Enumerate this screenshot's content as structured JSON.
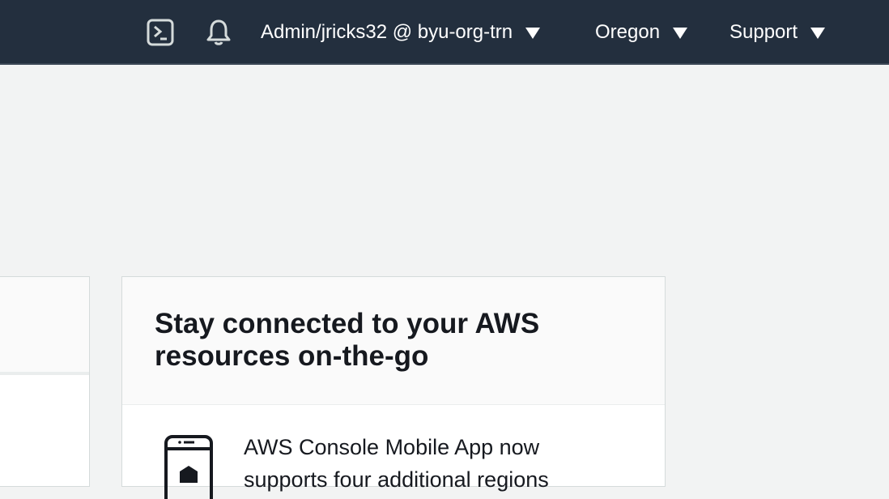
{
  "topbar": {
    "cloudshell_icon": "terminal-prompt-icon",
    "notifications_icon": "bell-icon",
    "account_label": "Admin/jricks32 @ byu-org-trn",
    "region_label": "Oregon",
    "support_label": "Support",
    "caret_icon": "caret-down-icon",
    "background_color": "#232f3e"
  },
  "card": {
    "title": "Stay connected to your AWS resources on-the-go",
    "icon": "mobile-phone-icon",
    "body_text_visible": "AWS Console Mobile App now",
    "body_text_partial": "supports four additional regions"
  }
}
